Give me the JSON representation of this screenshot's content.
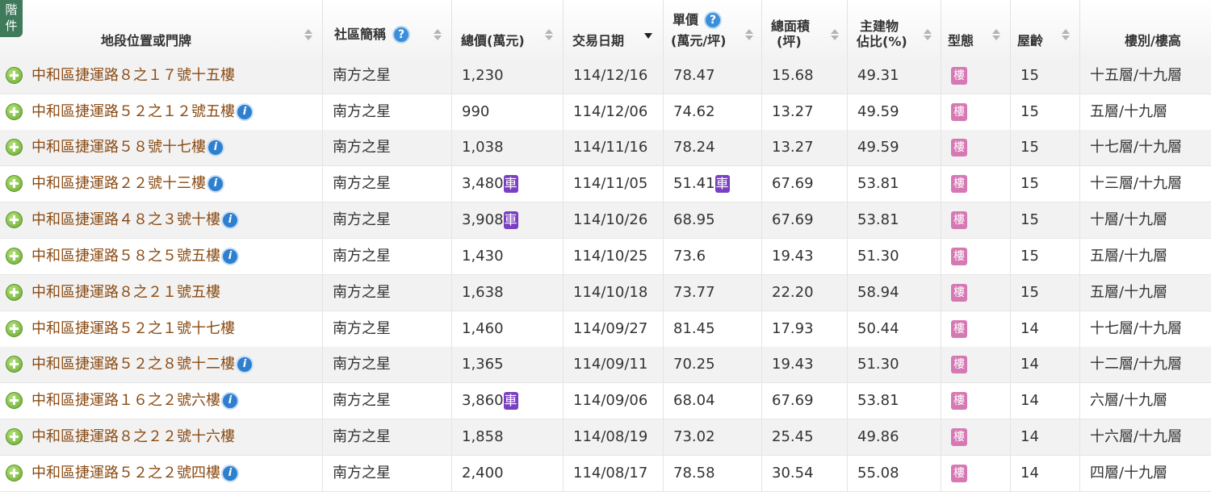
{
  "corner_tab": {
    "line1": "階",
    "line2": "件"
  },
  "header": {
    "address": "地段位置或門牌",
    "community": "社區簡稱",
    "total_price": "總價(萬元)",
    "trade_date": "交易日期",
    "unit_price_line1": "單價",
    "unit_price_line2": "(萬元/坪)",
    "area_line1": "總面積",
    "area_line2": "(坪)",
    "main_ratio_line1": "主建物",
    "main_ratio_line2": "佔比(%)",
    "type": "型態",
    "age": "屋齡",
    "floor": "樓別/樓高",
    "help_glyph": "?"
  },
  "badges": {
    "info": "i",
    "parking": "車",
    "building": "樓"
  },
  "colors": {
    "address_text": "#8a4a12",
    "parking_badge": "#7b3fc4",
    "building_badge": "#d678b4",
    "plus_icon": "#66a830",
    "info_icon": "#2f7fcf"
  },
  "rows": [
    {
      "address": "中和區捷運路８之１７號十五樓",
      "info": false,
      "community": "南方之星",
      "total": "1,230",
      "total_car": false,
      "date": "114/12/16",
      "unit": "78.47",
      "unit_car": false,
      "area": "15.68",
      "ratio": "49.31",
      "age": "15",
      "floor": "十五層/十九層"
    },
    {
      "address": "中和區捷運路５２之１２號五樓",
      "info": true,
      "community": "南方之星",
      "total": "990",
      "total_car": false,
      "date": "114/12/06",
      "unit": "74.62",
      "unit_car": false,
      "area": "13.27",
      "ratio": "49.59",
      "age": "15",
      "floor": "五層/十九層"
    },
    {
      "address": "中和區捷運路５８號十七樓",
      "info": true,
      "community": "南方之星",
      "total": "1,038",
      "total_car": false,
      "date": "114/11/16",
      "unit": "78.24",
      "unit_car": false,
      "area": "13.27",
      "ratio": "49.59",
      "age": "15",
      "floor": "十七層/十九層"
    },
    {
      "address": "中和區捷運路２２號十三樓",
      "info": true,
      "community": "南方之星",
      "total": "3,480",
      "total_car": true,
      "date": "114/11/05",
      "unit": "51.41",
      "unit_car": true,
      "area": "67.69",
      "ratio": "53.81",
      "age": "15",
      "floor": "十三層/十九層"
    },
    {
      "address": "中和區捷運路４８之３號十樓",
      "info": true,
      "community": "南方之星",
      "total": "3,908",
      "total_car": true,
      "date": "114/10/26",
      "unit": "68.95",
      "unit_car": false,
      "area": "67.69",
      "ratio": "53.81",
      "age": "15",
      "floor": "十層/十九層"
    },
    {
      "address": "中和區捷運路５８之５號五樓",
      "info": true,
      "community": "南方之星",
      "total": "1,430",
      "total_car": false,
      "date": "114/10/25",
      "unit": "73.6",
      "unit_car": false,
      "area": "19.43",
      "ratio": "51.30",
      "age": "15",
      "floor": "五層/十九層"
    },
    {
      "address": "中和區捷運路８之２１號五樓",
      "info": false,
      "community": "南方之星",
      "total": "1,638",
      "total_car": false,
      "date": "114/10/18",
      "unit": "73.77",
      "unit_car": false,
      "area": "22.20",
      "ratio": "58.94",
      "age": "15",
      "floor": "五層/十九層"
    },
    {
      "address": "中和區捷運路５２之１號十七樓",
      "info": false,
      "community": "南方之星",
      "total": "1,460",
      "total_car": false,
      "date": "114/09/27",
      "unit": "81.45",
      "unit_car": false,
      "area": "17.93",
      "ratio": "50.44",
      "age": "14",
      "floor": "十七層/十九層"
    },
    {
      "address": "中和區捷運路５２之８號十二樓",
      "info": true,
      "community": "南方之星",
      "total": "1,365",
      "total_car": false,
      "date": "114/09/11",
      "unit": "70.25",
      "unit_car": false,
      "area": "19.43",
      "ratio": "51.30",
      "age": "14",
      "floor": "十二層/十九層"
    },
    {
      "address": "中和區捷運路１６之２號六樓",
      "info": true,
      "community": "南方之星",
      "total": "3,860",
      "total_car": true,
      "date": "114/09/06",
      "unit": "68.04",
      "unit_car": false,
      "area": "67.69",
      "ratio": "53.81",
      "age": "14",
      "floor": "六層/十九層"
    },
    {
      "address": "中和區捷運路８之２２號十六樓",
      "info": false,
      "community": "南方之星",
      "total": "1,858",
      "total_car": false,
      "date": "114/08/19",
      "unit": "73.02",
      "unit_car": false,
      "area": "25.45",
      "ratio": "49.86",
      "age": "14",
      "floor": "十六層/十九層"
    },
    {
      "address": "中和區捷運路５２之２號四樓",
      "info": true,
      "community": "南方之星",
      "total": "2,400",
      "total_car": false,
      "date": "114/08/17",
      "unit": "78.58",
      "unit_car": false,
      "area": "30.54",
      "ratio": "55.08",
      "age": "14",
      "floor": "四層/十九層"
    }
  ]
}
